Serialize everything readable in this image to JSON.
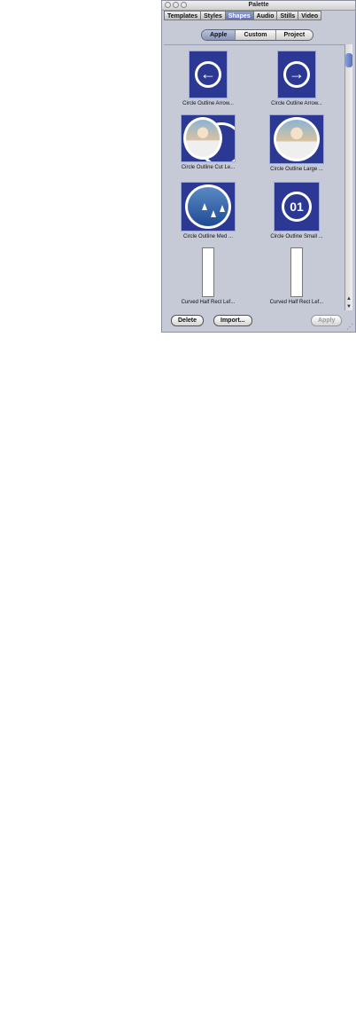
{
  "window": {
    "title": "Palette"
  },
  "tabs": [
    {
      "label": "Templates",
      "active": false
    },
    {
      "label": "Styles",
      "active": false
    },
    {
      "label": "Shapes",
      "active": true
    },
    {
      "label": "Audio",
      "active": false
    },
    {
      "label": "Stills",
      "active": false
    },
    {
      "label": "Video",
      "active": false
    }
  ],
  "segments": [
    {
      "label": "Apple",
      "active": true
    },
    {
      "label": "Custom",
      "active": false
    },
    {
      "label": "Project",
      "active": false
    }
  ],
  "shapes": [
    {
      "label": "Circle Outline Arrow...",
      "icon": "left-arrow-icon"
    },
    {
      "label": "Circle Outline Arrow...",
      "icon": "right-arrow-icon"
    },
    {
      "label": "Circle Outline Cut Le...",
      "icon": "people-photo"
    },
    {
      "label": "Circle Outline Large ...",
      "icon": "people-photo"
    },
    {
      "label": "Circle Outline Med ...",
      "icon": "boats-photo"
    },
    {
      "label": "Circle Outline Small ...",
      "icon": "number-icon",
      "number": "01"
    },
    {
      "label": "Curved Half Rect Lef...",
      "icon": "white-rect"
    },
    {
      "label": "Curved Half Rect Lef...",
      "icon": "white-rect"
    }
  ],
  "glyphs": {
    "left_arrow": "←",
    "right_arrow": "→",
    "scroll_up": "▲",
    "scroll_down": "▼",
    "grow": "⋰"
  },
  "buttons": {
    "delete": "Delete",
    "import": "Import...",
    "apply": "Apply"
  }
}
